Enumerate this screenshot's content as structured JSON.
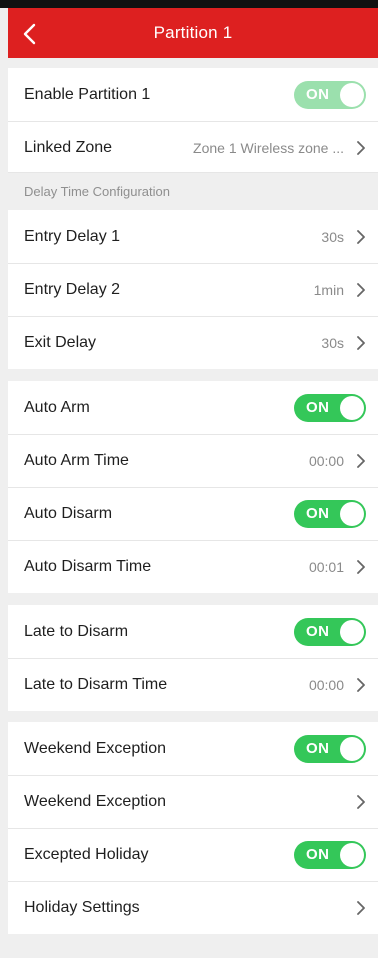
{
  "header": {
    "title": "Partition 1"
  },
  "rows": {
    "enable_partition": {
      "label": "Enable Partition 1",
      "toggle": "ON"
    },
    "linked_zone": {
      "label": "Linked Zone",
      "value": "Zone 1  Wireless zone ..."
    },
    "delay_section": "Delay Time Configuration",
    "entry_delay_1": {
      "label": "Entry Delay 1",
      "value": "30s"
    },
    "entry_delay_2": {
      "label": "Entry Delay 2",
      "value": "1min"
    },
    "exit_delay": {
      "label": "Exit Delay",
      "value": "30s"
    },
    "auto_arm": {
      "label": "Auto Arm",
      "toggle": "ON"
    },
    "auto_arm_time": {
      "label": "Auto Arm Time",
      "value": "00:00"
    },
    "auto_disarm": {
      "label": "Auto Disarm",
      "toggle": "ON"
    },
    "auto_disarm_time": {
      "label": "Auto Disarm Time",
      "value": "00:01"
    },
    "late_to_disarm": {
      "label": "Late to Disarm",
      "toggle": "ON"
    },
    "late_to_disarm_time": {
      "label": "Late to Disarm Time",
      "value": "00:00"
    },
    "weekend_exception_toggle": {
      "label": "Weekend Exception",
      "toggle": "ON"
    },
    "weekend_exception_link": {
      "label": "Weekend Exception"
    },
    "excepted_holiday": {
      "label": "Excepted Holiday",
      "toggle": "ON"
    },
    "holiday_settings": {
      "label": "Holiday Settings"
    }
  },
  "colors": {
    "header_red": "#dd2020",
    "toggle_green": "#34c759",
    "toggle_green_dimmed": "#9be0ad"
  }
}
